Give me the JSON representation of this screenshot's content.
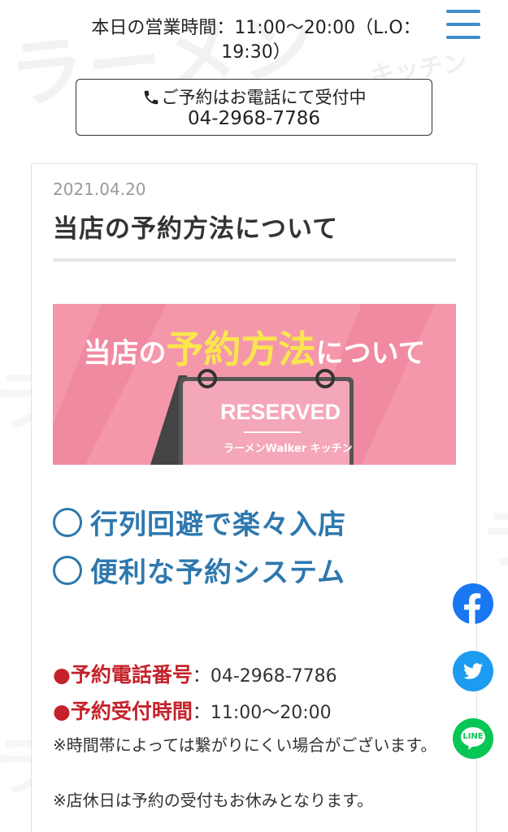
{
  "header": {
    "hours": "本日の営業時間：11:00〜20:00（L.O：19:30）",
    "menu_icon": "hamburger-menu-icon"
  },
  "reserve": {
    "line1": "ご予約はお電話にて受付中",
    "phone": "04-2968-7786",
    "icon": "phone-icon"
  },
  "post": {
    "date": "2021.04.20",
    "title": "当店の予約方法について"
  },
  "banner": {
    "text_prefix": "当店の",
    "text_highlight": "予約方法",
    "text_suffix": "について",
    "sign_text": "RESERVED",
    "sign_logo": "ラーメンWalker キッチン"
  },
  "features": [
    {
      "label": "行列回避で楽々入店"
    },
    {
      "label": "便利な予約システム"
    }
  ],
  "info": {
    "phone_label": "●予約電話番号",
    "phone_value": "：04-2968-7786",
    "hours_label": "●予約受付時間",
    "hours_value": "：11:00〜20:00",
    "note1": "※時間帯によっては繋がりにくい場合がございます。",
    "note2": "※店休日は予約の受付もお休みとなります。"
  },
  "social": {
    "facebook_icon": "facebook-icon",
    "twitter_icon": "twitter-icon",
    "line_icon": "line-icon",
    "line_label": "LINE"
  },
  "watermark": {
    "logo": "ラーメンWalker キッチン"
  },
  "colors": {
    "accent_blue": "#2e78ae",
    "menu_blue": "#3d8fce",
    "red": "#c4222a",
    "banner_pink": "#f497ab",
    "highlight_yellow": "#fbe64c"
  }
}
